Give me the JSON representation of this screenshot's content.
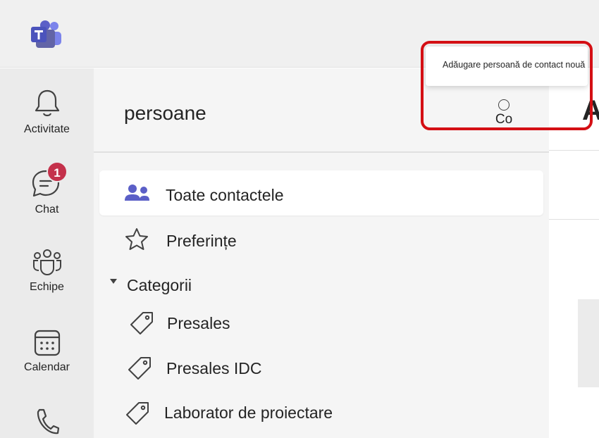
{
  "app": {
    "logo_icon": "teams-logo-icon"
  },
  "rail": {
    "items": [
      {
        "label": "Activitate",
        "icon": "bell-icon"
      },
      {
        "label": "Chat",
        "icon": "chat-icon",
        "badge": "1"
      },
      {
        "label": "Echipe",
        "icon": "teams-icon"
      },
      {
        "label": "Calendar",
        "icon": "calendar-icon"
      },
      {
        "label": "",
        "icon": "phone-icon"
      }
    ]
  },
  "panel": {
    "title": "persoane",
    "action_button_label": "Co",
    "tooltip": "Adăugare persoană de contact nouă",
    "nav": {
      "all_contacts": "Toate contactele",
      "favorites": "Preferințe",
      "categories_header": "Categorii",
      "categories": [
        "Presales",
        "Presales IDC",
        "Laborator de proiectare"
      ]
    }
  },
  "right": {
    "heading_fragment": "A"
  },
  "colors": {
    "accent": "#5b5fc7",
    "badge": "#c4314b",
    "highlight": "#d40f14"
  }
}
